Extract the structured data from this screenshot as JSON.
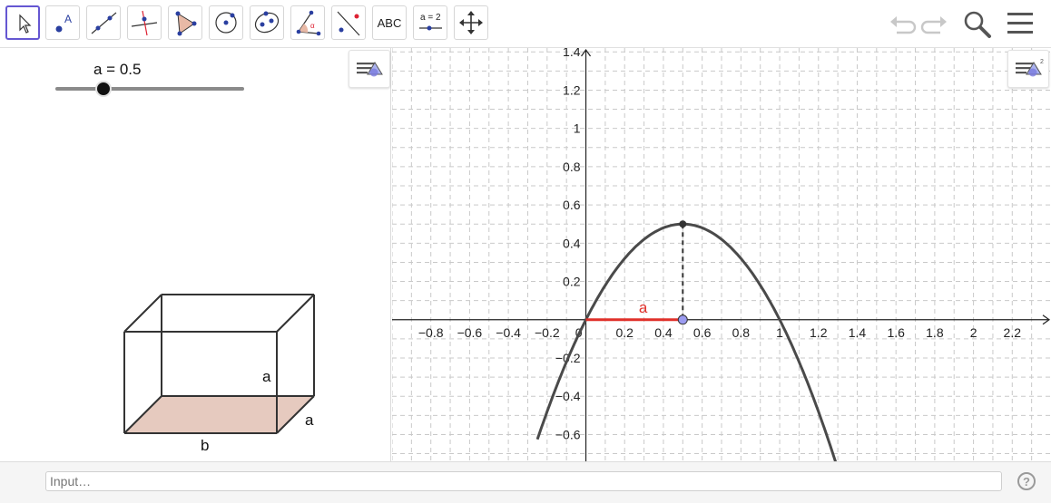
{
  "toolbar": {
    "tools": [
      {
        "id": "move",
        "icon": "move-pointer-icon",
        "selected": true
      },
      {
        "id": "point",
        "icon": "point-icon",
        "label": "A"
      },
      {
        "id": "line",
        "icon": "line-icon"
      },
      {
        "id": "perpendicular",
        "icon": "perpendicular-line-icon"
      },
      {
        "id": "polygon",
        "icon": "polygon-icon"
      },
      {
        "id": "circle",
        "icon": "circle-icon"
      },
      {
        "id": "ellipse",
        "icon": "ellipse-icon"
      },
      {
        "id": "angle",
        "icon": "angle-icon"
      },
      {
        "id": "reflect",
        "icon": "reflect-icon"
      },
      {
        "id": "text",
        "icon": "text-icon",
        "label": "ABC"
      },
      {
        "id": "slider",
        "icon": "slider-icon",
        "label": "a = 2"
      },
      {
        "id": "move-view",
        "icon": "move-graphics-view-icon"
      }
    ],
    "right_icons": [
      "undo-icon",
      "redo-icon",
      "search-icon",
      "menu-icon"
    ]
  },
  "algebra": {
    "slider_label": "a = 0.5",
    "slider_value": 0.5,
    "slider_min": 0,
    "slider_max": 2,
    "box_labels": {
      "height": "a",
      "depth": "a",
      "width": "b"
    },
    "base_color": "#e6cabf"
  },
  "graphics": {
    "x_ticks": [
      -0.8,
      -0.6,
      -0.4,
      -0.2,
      0.2,
      0.4,
      0.6,
      0.8,
      1,
      1.2,
      1.4,
      1.6,
      1.8,
      2,
      2.2
    ],
    "y_ticks": [
      -0.6,
      -0.4,
      -0.2,
      0.2,
      0.4,
      0.6,
      0.8,
      1,
      1.2,
      1.4
    ],
    "origin_label": "0",
    "xlim": [
      -1.0,
      2.4
    ],
    "ylim": [
      -0.74,
      1.42
    ],
    "curve_color": "#4a4a4a",
    "segment_color": "#e0302a",
    "segment_label": "a",
    "point_color": "#9b9bf0"
  },
  "input": {
    "placeholder": "Input…"
  },
  "help_label": "?"
}
